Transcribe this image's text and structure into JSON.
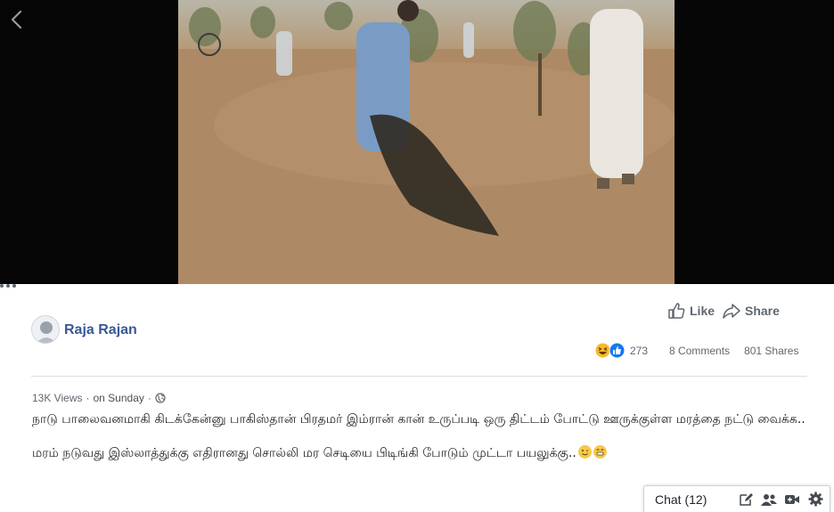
{
  "viewer": {
    "back_icon": "chevron-left-icon",
    "video_description": ""
  },
  "post": {
    "author": "Raja Rajan",
    "actions": {
      "like_label": "Like",
      "share_label": "Share",
      "more_icon": "more-dots-icon"
    },
    "stats": {
      "reactions": [
        "haha",
        "like"
      ],
      "reaction_count": "273",
      "comments": "8 Comments",
      "shares": "801 Shares"
    },
    "meta": {
      "views": "13K Views",
      "separator": "·",
      "time": "on Sunday",
      "privacy_icon": "globe-icon"
    },
    "text": {
      "line1": "நாடு பாலைவனமாகி கிடக்கேன்னு பாகிஸ்தான் பிரதமர் இம்ரான் கான் உருப்படி ஒரு திட்டம் போட்டு ஊருக்குள்ள மரத்தை நட்டு வைக்க..",
      "line2": "மரம் நடுவது இஸ்லாத்துக்கு எதிரானது சொல்லி மர செடியை பிடிங்கி போடும் முட்டா பயலுக்கு.."
    }
  },
  "chat": {
    "label": "Chat (12)",
    "icons": [
      "compose-icon",
      "group-icon",
      "video-call-icon",
      "settings-icon"
    ]
  },
  "colors": {
    "link": "#385898",
    "secondary_text": "#606770",
    "body_text": "#1c1e21",
    "divider": "#dadde1",
    "like_blue": "#1877f2"
  }
}
